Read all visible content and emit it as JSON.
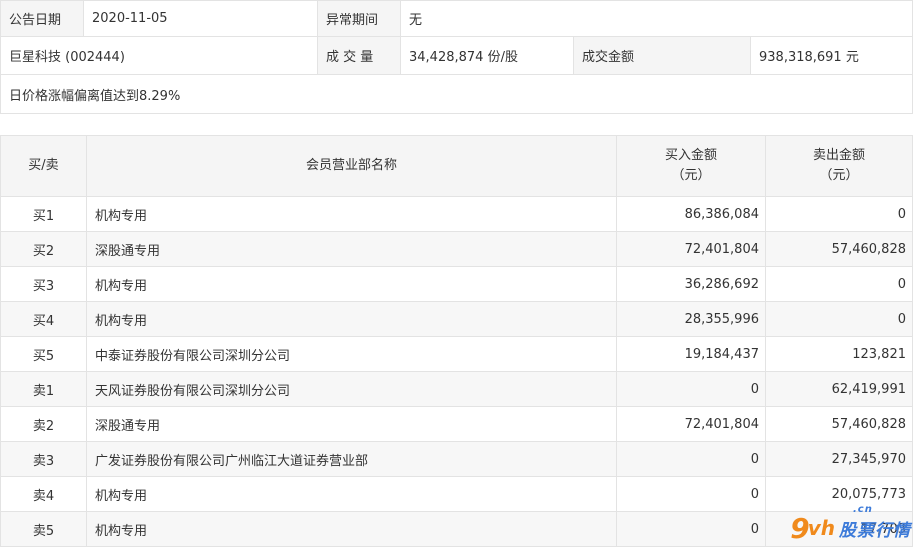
{
  "info": {
    "date_label": "公告日期",
    "date_value": "2020-11-05",
    "abnormal_label": "异常期间",
    "abnormal_value": "无",
    "stock": "巨星科技 (002444)",
    "volume_label": "成 交 量",
    "volume_value": "34,428,874 份/股",
    "amount_label": "成交金额",
    "amount_value": "938,318,691 元",
    "reason": "日价格涨幅偏离值达到8.29%"
  },
  "table": {
    "headers": {
      "side": "买/卖",
      "branch": "会员营业部名称",
      "buy_line1": "买入金额",
      "buy_line2": "（元）",
      "sell_line1": "卖出金额",
      "sell_line2": "（元）"
    },
    "rows": [
      {
        "side": "买1",
        "branch": "机构专用",
        "buy": "86,386,084",
        "sell": "0"
      },
      {
        "side": "买2",
        "branch": "深股通专用",
        "buy": "72,401,804",
        "sell": "57,460,828"
      },
      {
        "side": "买3",
        "branch": "机构专用",
        "buy": "36,286,692",
        "sell": "0"
      },
      {
        "side": "买4",
        "branch": "机构专用",
        "buy": "28,355,996",
        "sell": "0"
      },
      {
        "side": "买5",
        "branch": "中泰证券股份有限公司深圳分公司",
        "buy": "19,184,437",
        "sell": "123,821"
      },
      {
        "side": "卖1",
        "branch": "天风证券股份有限公司深圳分公司",
        "buy": "0",
        "sell": "62,419,991"
      },
      {
        "side": "卖2",
        "branch": "深股通专用",
        "buy": "72,401,804",
        "sell": "57,460,828"
      },
      {
        "side": "卖3",
        "branch": "广发证券股份有限公司广州临江大道证券营业部",
        "buy": "0",
        "sell": "27,345,970"
      },
      {
        "side": "卖4",
        "branch": "机构专用",
        "buy": "0",
        "sell": "20,075,773"
      },
      {
        "side": "卖5",
        "branch": "机构专用",
        "buy": "0",
        "sell": "17,703"
      }
    ]
  },
  "watermark": {
    "logo_9": "9",
    "logo_vh": "vh",
    "logo_cn": ".cn",
    "logo_text": "股票行情"
  }
}
